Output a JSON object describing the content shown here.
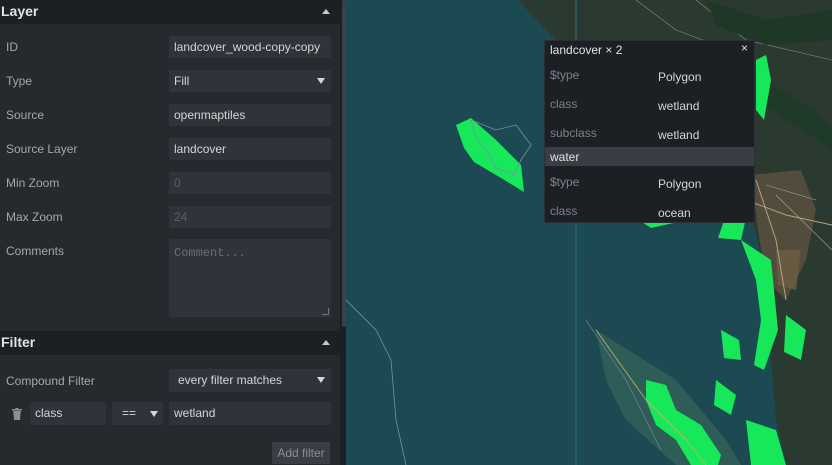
{
  "layer_section": {
    "title": "Layer",
    "id_label": "ID",
    "id_value": "landcover_wood-copy-copy",
    "type_label": "Type",
    "type_value": "Fill",
    "source_label": "Source",
    "source_value": "openmaptiles",
    "source_layer_label": "Source Layer",
    "source_layer_value": "landcover",
    "min_zoom_label": "Min Zoom",
    "min_zoom_value": "0",
    "max_zoom_label": "Max Zoom",
    "max_zoom_value": "24",
    "comments_label": "Comments",
    "comments_placeholder": "Comment..."
  },
  "filter_section": {
    "title": "Filter",
    "compound_label": "Compound Filter",
    "compound_value": "every filter matches",
    "filter_key": "class",
    "filter_op": "==",
    "filter_value": "wetland",
    "add_filter_label": "Add filter"
  },
  "popup": {
    "title": "landcover × 2",
    "close": "×",
    "feature1": {
      "type_key": "$type",
      "type_value": "Polygon",
      "class_key": "class",
      "class_value": "wetland",
      "subclass_key": "subclass",
      "subclass_value": "wetland"
    },
    "layer2_name": "water",
    "feature2": {
      "type_key": "$type",
      "type_value": "Polygon",
      "class_key": "class",
      "class_value": "ocean"
    }
  },
  "colors": {
    "panel_bg": "#26292e",
    "header_bg": "#1c1f24",
    "field_bg": "#30333a",
    "water": "#1c4a52",
    "wetland_fill": "#17e85a",
    "land": "#2d3b32"
  },
  "icons": {
    "collapse": "triangle-up-icon",
    "dropdown": "chevron-down-icon",
    "trash": "trash-icon",
    "close": "close-icon"
  }
}
